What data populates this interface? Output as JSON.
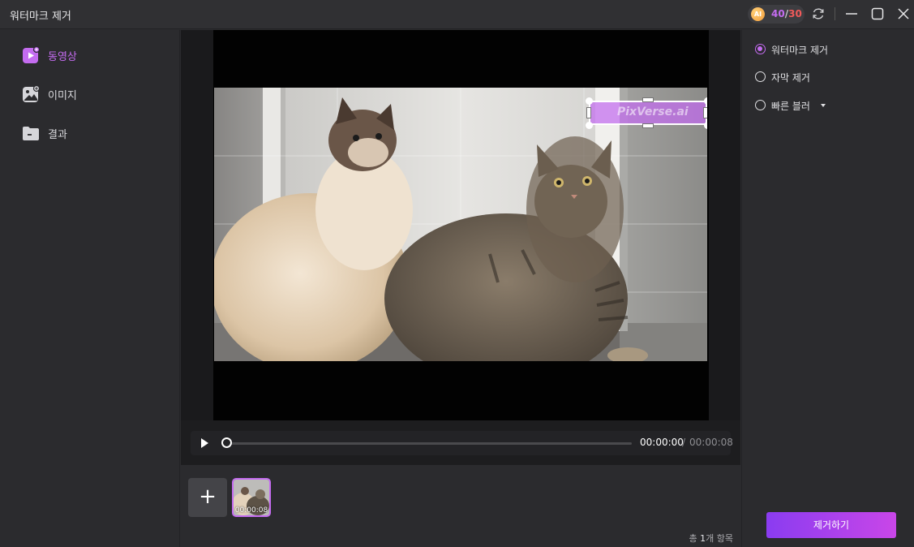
{
  "window": {
    "title": "워터마크 제거",
    "credits": {
      "badge": "AI",
      "used": "40",
      "separator": "/",
      "total": "30"
    }
  },
  "sidebar": {
    "items": [
      {
        "label": "동영상",
        "icon": "video-add-icon",
        "active": true
      },
      {
        "label": "이미지",
        "icon": "image-add-icon",
        "active": false
      },
      {
        "label": "결과",
        "icon": "folder-icon",
        "active": false
      }
    ]
  },
  "preview": {
    "watermark_text": "PixVerse.ai"
  },
  "player": {
    "current_time": "00:00:00",
    "separator": "/",
    "total_time": "00:00:08",
    "progress": 0
  },
  "media": {
    "add_label": "+",
    "thumb_duration": "00:00:08",
    "count_prefix": "총 ",
    "count_value": "1",
    "count_suffix": "개 항목"
  },
  "options": {
    "items": [
      {
        "label": "워터마크 제거",
        "selected": true
      },
      {
        "label": "자막 제거",
        "selected": false
      },
      {
        "label": "빠른 블러",
        "selected": false,
        "dropdown": true
      }
    ],
    "action_label": "제거하기"
  },
  "colors": {
    "accent": "#c46cf0",
    "credit_total": "#f05a5a",
    "button_gradient_start": "#8a3cf0",
    "button_gradient_end": "#c946e8"
  }
}
